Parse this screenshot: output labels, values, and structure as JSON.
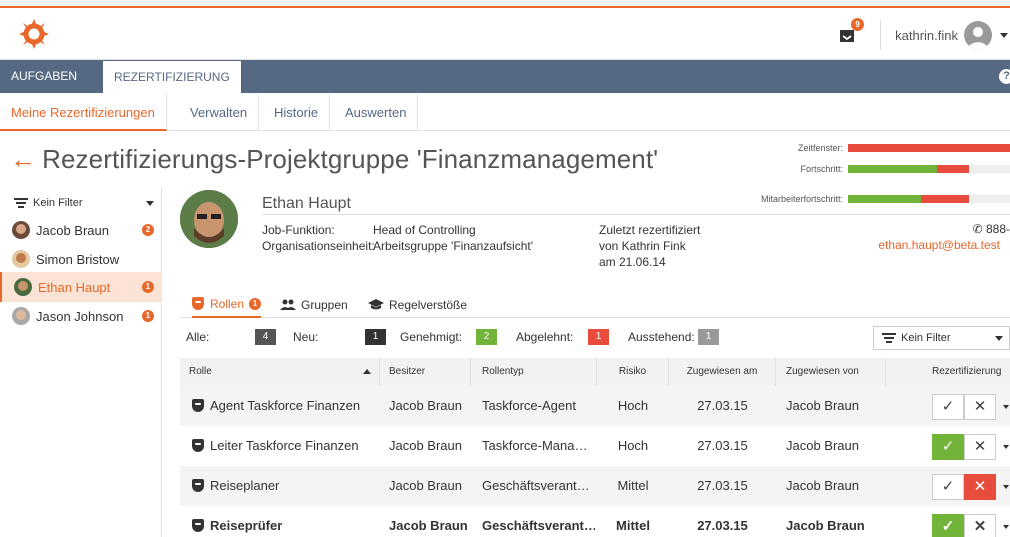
{
  "header": {
    "username": "kathrin.fink",
    "notification_count": "9",
    "help_label": "?"
  },
  "main_nav": {
    "tabs": [
      {
        "label": "AUFGABEN"
      },
      {
        "label": "REZERTIFIZIERUNG"
      }
    ]
  },
  "sub_nav": {
    "tabs": [
      {
        "label": "Meine Rezertifizierungen"
      },
      {
        "label": "Verwalten"
      },
      {
        "label": "Historie"
      },
      {
        "label": "Auswerten"
      }
    ]
  },
  "page": {
    "title": "Rezertifizierungs-Projektgruppe 'Finanzmanagement'"
  },
  "progress": {
    "zeitfenster_label": "Zeitfenster:",
    "fortschritt_label": "Fortschritt:",
    "mitarbeiter_label": "Mitarbeiterfortschritt:",
    "zeitfenster": {
      "red": 1.0
    },
    "fortschritt": {
      "green": 0.55,
      "red": 0.2
    },
    "mitarbeiter": {
      "green": 0.45,
      "red": 0.3
    }
  },
  "sidebar": {
    "filter_label": "Kein Filter",
    "persons": [
      {
        "name": "Jacob Braun",
        "badge": "2"
      },
      {
        "name": "Simon Bristow",
        "badge": ""
      },
      {
        "name": "Ethan Haupt",
        "badge": "1"
      },
      {
        "name": "Jason Johnson",
        "badge": "1"
      }
    ]
  },
  "profile": {
    "name": "Ethan Haupt",
    "job_label": "Job-Funktion:",
    "job_value": "Head of Controlling",
    "org_label": "Organisationseinheit:",
    "org_value": "Arbeitsgruppe 'Finanzaufsicht'",
    "recert_line1": "Zuletzt rezertifiziert",
    "recert_line2": "von Kathrin Fink",
    "recert_line3": "am 21.06.14",
    "phone": "888-",
    "email": "ethan.haupt@beta.test"
  },
  "role_tabs": [
    {
      "label": "Rollen",
      "badge": "1"
    },
    {
      "label": "Gruppen"
    },
    {
      "label": "Regelverstöße"
    }
  ],
  "counts": [
    {
      "label": "Alle:",
      "value": "4",
      "color": "#555555"
    },
    {
      "label": "Neu:",
      "value": "1",
      "color": "#333333"
    },
    {
      "label": "Genehmigt:",
      "value": "2",
      "color": "#72b33a"
    },
    {
      "label": "Abgelehnt:",
      "value": "1",
      "color": "#e74c3c"
    },
    {
      "label": "Ausstehend:",
      "value": "1",
      "color": "#999999"
    }
  ],
  "table_filter": "Kein Filter",
  "table": {
    "headers": [
      "Rolle",
      "Besitzer",
      "Rollentyp",
      "Risiko",
      "Zugewiesen am",
      "Zugewiesen von",
      "Rezertifizierung"
    ],
    "rows": [
      {
        "rolle": "Agent Taskforce Finanzen",
        "besitzer": "Jacob Braun",
        "typ": "Taskforce-Agent",
        "risiko": "Hoch",
        "am": "27.03.15",
        "von": "Jacob Braun",
        "state": "none"
      },
      {
        "rolle": "Leiter Taskforce Finanzen",
        "besitzer": "Jacob Braun",
        "typ": "Taskforce-Mana…",
        "risiko": "Hoch",
        "am": "27.03.15",
        "von": "Jacob Braun",
        "state": "approved"
      },
      {
        "rolle": "Reiseplaner",
        "besitzer": "Jacob Braun",
        "typ": "Geschäftsverant…",
        "risiko": "Mittel",
        "am": "27.03.15",
        "von": "Jacob Braun",
        "state": "rejected"
      },
      {
        "rolle": "Reiseprüfer",
        "besitzer": "Jacob Braun",
        "typ": "Geschäftsverant…",
        "risiko": "Mittel",
        "am": "27.03.15",
        "von": "Jacob Braun",
        "state": "approved"
      }
    ]
  },
  "colors": {
    "accent": "#e8672a",
    "nav": "#556983",
    "approve": "#72b33a",
    "reject": "#e74c3c"
  }
}
